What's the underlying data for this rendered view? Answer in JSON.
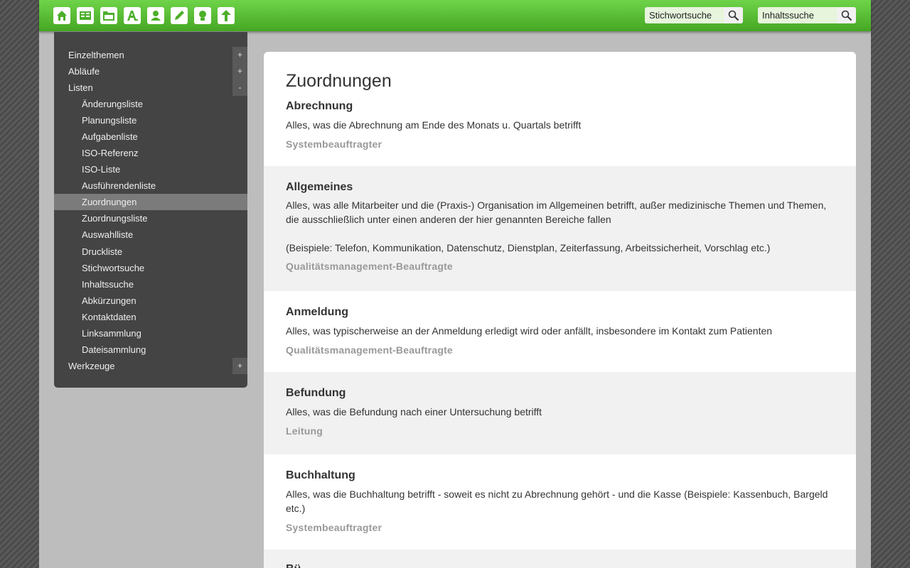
{
  "toolbar": {
    "icons": [
      {
        "name": "home-icon"
      },
      {
        "name": "book-icon"
      },
      {
        "name": "folder-icon"
      },
      {
        "name": "font-icon"
      },
      {
        "name": "user-icon"
      },
      {
        "name": "pencil-icon"
      },
      {
        "name": "lightbulb-icon"
      },
      {
        "name": "arrow-up-icon"
      }
    ],
    "search_keyword_value": "Stichwortsuche",
    "search_content_value": "Inhaltssuche"
  },
  "sidebar": {
    "items": [
      {
        "label": "Einzelthemen",
        "toggle": "+"
      },
      {
        "label": "Abläufe",
        "toggle": "+"
      },
      {
        "label": "Listen",
        "toggle": "-"
      },
      {
        "label": "Änderungsliste"
      },
      {
        "label": "Planungsliste"
      },
      {
        "label": "Aufgabenliste"
      },
      {
        "label": "ISO-Referenz"
      },
      {
        "label": "ISO-Liste"
      },
      {
        "label": "Ausführendenliste"
      },
      {
        "label": "Zuordnungen"
      },
      {
        "label": "Zuordnungsliste"
      },
      {
        "label": "Auswahlliste"
      },
      {
        "label": "Druckliste"
      },
      {
        "label": "Stichwortsuche"
      },
      {
        "label": "Inhaltssuche"
      },
      {
        "label": "Abkürzungen"
      },
      {
        "label": "Kontaktdaten"
      },
      {
        "label": "Linksammlung"
      },
      {
        "label": "Dateisammlung"
      },
      {
        "label": "Werkzeuge",
        "toggle": "+"
      }
    ]
  },
  "main": {
    "title": "Zuordnungen",
    "entries": [
      {
        "title": "Abrechnung",
        "desc": "Alles, was die Abrechnung am Ende des Monats u. Quartals betrifft",
        "role": "Systembeauftragter"
      },
      {
        "title": "Allgemeines",
        "desc": "Alles, was alle Mitarbeiter und die (Praxis-) Organisation im Allgemeinen betrifft, außer medizinische Themen und Themen, die ausschließlich unter einen anderen der hier genannten Bereiche fallen",
        "desc2": "(Beispiele: Telefon, Kommunikation, Datenschutz, Dienstplan, Zeiterfassung, Arbeitssicherheit, Vorschlag etc.)",
        "role": "Qualitätsmanagement-Beauftragte"
      },
      {
        "title": "Anmeldung",
        "desc": "Alles, was typischerweise an der Anmeldung erledigt wird oder anfällt, insbesondere im Kontakt zum Patienten",
        "role": "Qualitätsmanagement-Beauftragte"
      },
      {
        "title": "Befundung",
        "desc": "Alles, was die Befundung nach einer Untersuchung betrifft",
        "role": "Leitung"
      },
      {
        "title": "Buchhaltung",
        "desc": "Alles, was die Buchhaltung betrifft - soweit es nicht zu Abrechnung gehört - und die Kasse (Beispiele: Kassenbuch, Bargeld etc.)",
        "role": "Systembeauftragter"
      },
      {
        "title": "Bü"
      }
    ]
  }
}
